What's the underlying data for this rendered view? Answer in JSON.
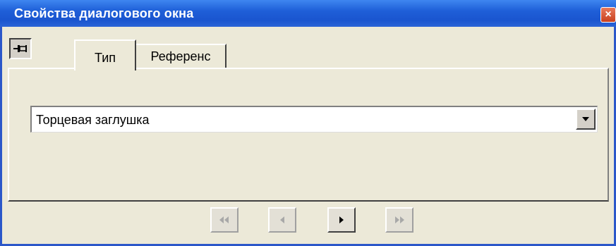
{
  "window": {
    "title": "Свойства диалогового окна",
    "close_glyph": "×"
  },
  "toolbar": {
    "pin_icon": "pushpin-icon"
  },
  "tabs": [
    {
      "label": "Тип",
      "active": true
    },
    {
      "label": "Референс",
      "active": false
    }
  ],
  "type_select": {
    "value": "Торцевая заглушка",
    "arrow_icon": "chevron-down-icon"
  },
  "navigation": {
    "first": {
      "icon": "first-page-icon",
      "enabled": false
    },
    "previous": {
      "icon": "previous-icon",
      "enabled": false
    },
    "next": {
      "icon": "next-icon",
      "enabled": true
    },
    "last": {
      "icon": "last-page-icon",
      "enabled": false
    }
  },
  "colors": {
    "titlebar": "#1f5fd8",
    "window_bg": "#ece9d8",
    "disabled_glyph": "#a8a8a8"
  }
}
